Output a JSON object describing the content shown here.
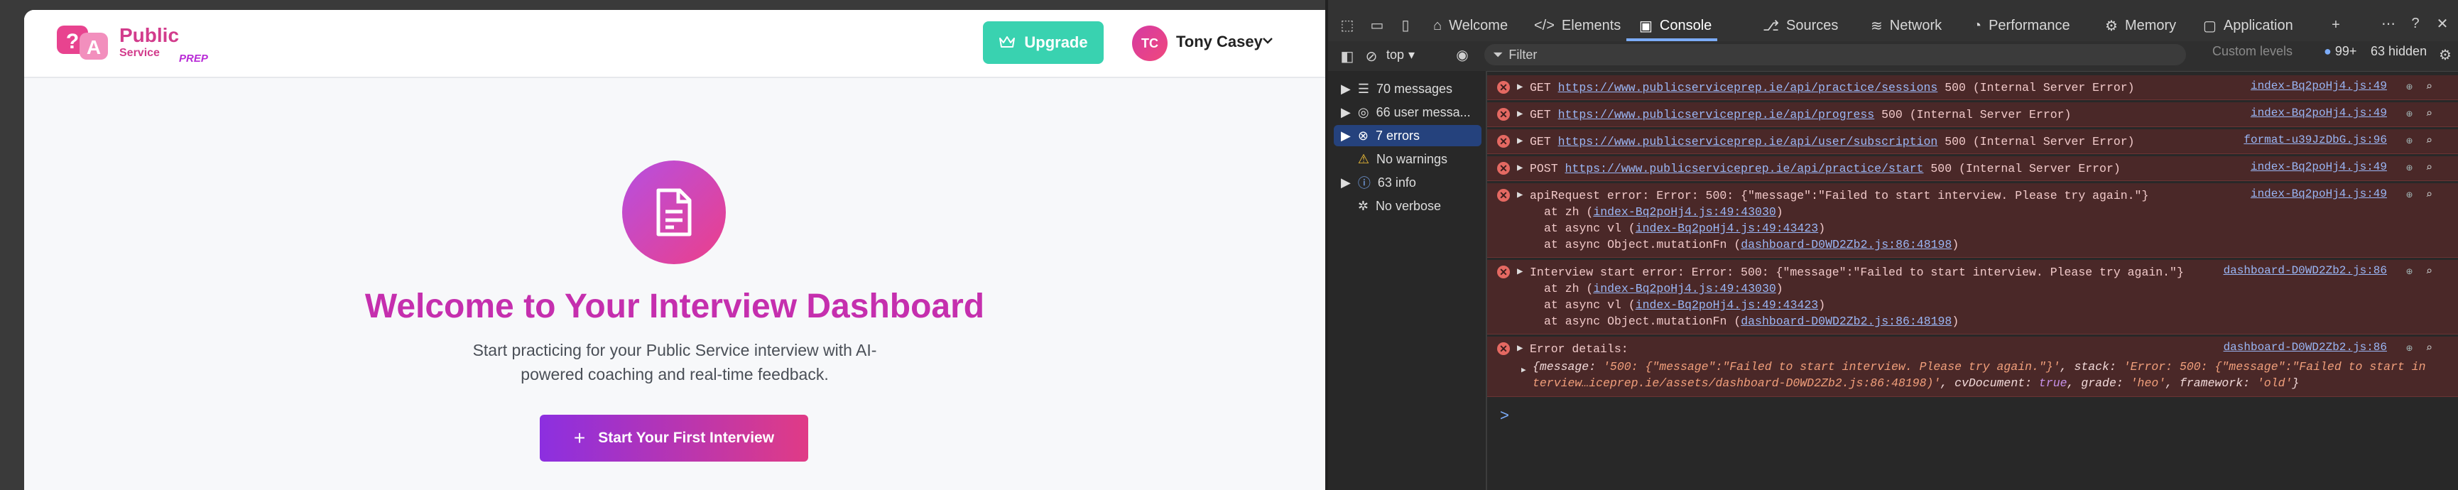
{
  "app": {
    "logo": {
      "name": "Public",
      "sub": "Service",
      "tag": "PREP"
    },
    "upgrade_label": "Upgrade",
    "user": {
      "initials": "TC",
      "name": "Tony Casey"
    },
    "hero": {
      "title": "Welcome to Your Interview Dashboard",
      "subtitle": "Start practicing for your Public Service interview with AI-powered coaching and real-time feedback.",
      "cta": "Start Your First Interview",
      "cta_icon": "+"
    }
  },
  "devtools": {
    "tabs": [
      {
        "label": "Welcome",
        "icon": "home-icon"
      },
      {
        "label": "Elements",
        "icon": "code-icon"
      },
      {
        "label": "Console",
        "icon": "console-icon"
      },
      {
        "label": "Sources",
        "icon": "sources-icon"
      },
      {
        "label": "Network",
        "icon": "wifi-icon"
      },
      {
        "label": "Performance",
        "icon": "gauge-icon"
      },
      {
        "label": "Memory",
        "icon": "chip-icon"
      },
      {
        "label": "Application",
        "icon": "app-icon"
      }
    ],
    "toolbar": {
      "context": "top",
      "filter_placeholder": "Filter",
      "levels": "Custom levels",
      "issues": "99+",
      "hidden": "63 hidden"
    },
    "sidebar": [
      {
        "label": "70 messages",
        "icon": "list-icon"
      },
      {
        "label": "66 user messa...",
        "icon": "user-icon"
      },
      {
        "label": "7 errors",
        "icon": "error-icon"
      },
      {
        "label": "No warnings",
        "icon": "warning-icon"
      },
      {
        "label": "63 info",
        "icon": "info-icon"
      },
      {
        "label": "No verbose",
        "icon": "bug-icon"
      }
    ],
    "log": {
      "r1": {
        "method": "GET",
        "url": "https://www.publicserviceprep.ie/api/practice/sessions",
        "status": "500 (Internal Server Error)",
        "src": "index-Bq2poHj4.js:49"
      },
      "r2": {
        "method": "GET",
        "url": "https://www.publicserviceprep.ie/api/progress",
        "status": "500 (Internal Server Error)",
        "src": "index-Bq2poHj4.js:49"
      },
      "r3": {
        "method": "GET",
        "url": "https://www.publicserviceprep.ie/api/user/subscription",
        "status": "500 (Internal Server Error)",
        "src": "format-u39JzDbG.js:96"
      },
      "r4": {
        "method": "POST",
        "url": "https://www.publicserviceprep.ie/api/practice/start",
        "status": "500 (Internal Server Error)",
        "src": "index-Bq2poHj4.js:49"
      },
      "r5": {
        "text": "apiRequest error: Error: 500: {\"message\":\"Failed to start interview. Please try again.\"}",
        "src": "index-Bq2poHj4.js:49",
        "s1_pre": "at zh (",
        "s1_link": "index-Bq2poHj4.js:49:43030",
        "s2_pre": "at async vl (",
        "s2_link": "index-Bq2poHj4.js:49:43423",
        "s3_pre": "at async Object.mutationFn (",
        "s3_link": "dashboard-D0WD2Zb2.js:86:48198",
        "close": ")"
      },
      "r6": {
        "text": "Interview start error: Error: 500: {\"message\":\"Failed to start interview. Please try again.\"}",
        "src": "dashboard-D0WD2Zb2.js:86",
        "s1_pre": "at zh (",
        "s1_link": "index-Bq2poHj4.js:49:43030",
        "s2_pre": "at async vl (",
        "s2_link": "index-Bq2poHj4.js:49:43423",
        "s3_pre": "at async Object.mutationFn (",
        "s3_link": "dashboard-D0WD2Zb2.js:86:48198",
        "close": ")"
      },
      "r7": {
        "text": "Error details:",
        "src": "dashboard-D0WD2Zb2.js:86",
        "l1_a": "{message: ",
        "l1_b": "'500: {\"message\":\"Failed to start interview. Please try again.\"}'",
        "l1_c": ", stack: ",
        "l1_d": "'Error: 500: {\"message\":\"Failed to start in",
        "l2_a": "terview…iceprep.ie/assets/dashboard-D0WD2Zb2.js:86:48198)'",
        "l2_b": ", cvDocument: ",
        "l2_c": "true",
        "l2_d": ", grade: ",
        "l2_e": "'heo'",
        "l2_f": ", framework: ",
        "l2_g": "'old'",
        "l2_h": "}"
      }
    },
    "prompt": ">"
  }
}
